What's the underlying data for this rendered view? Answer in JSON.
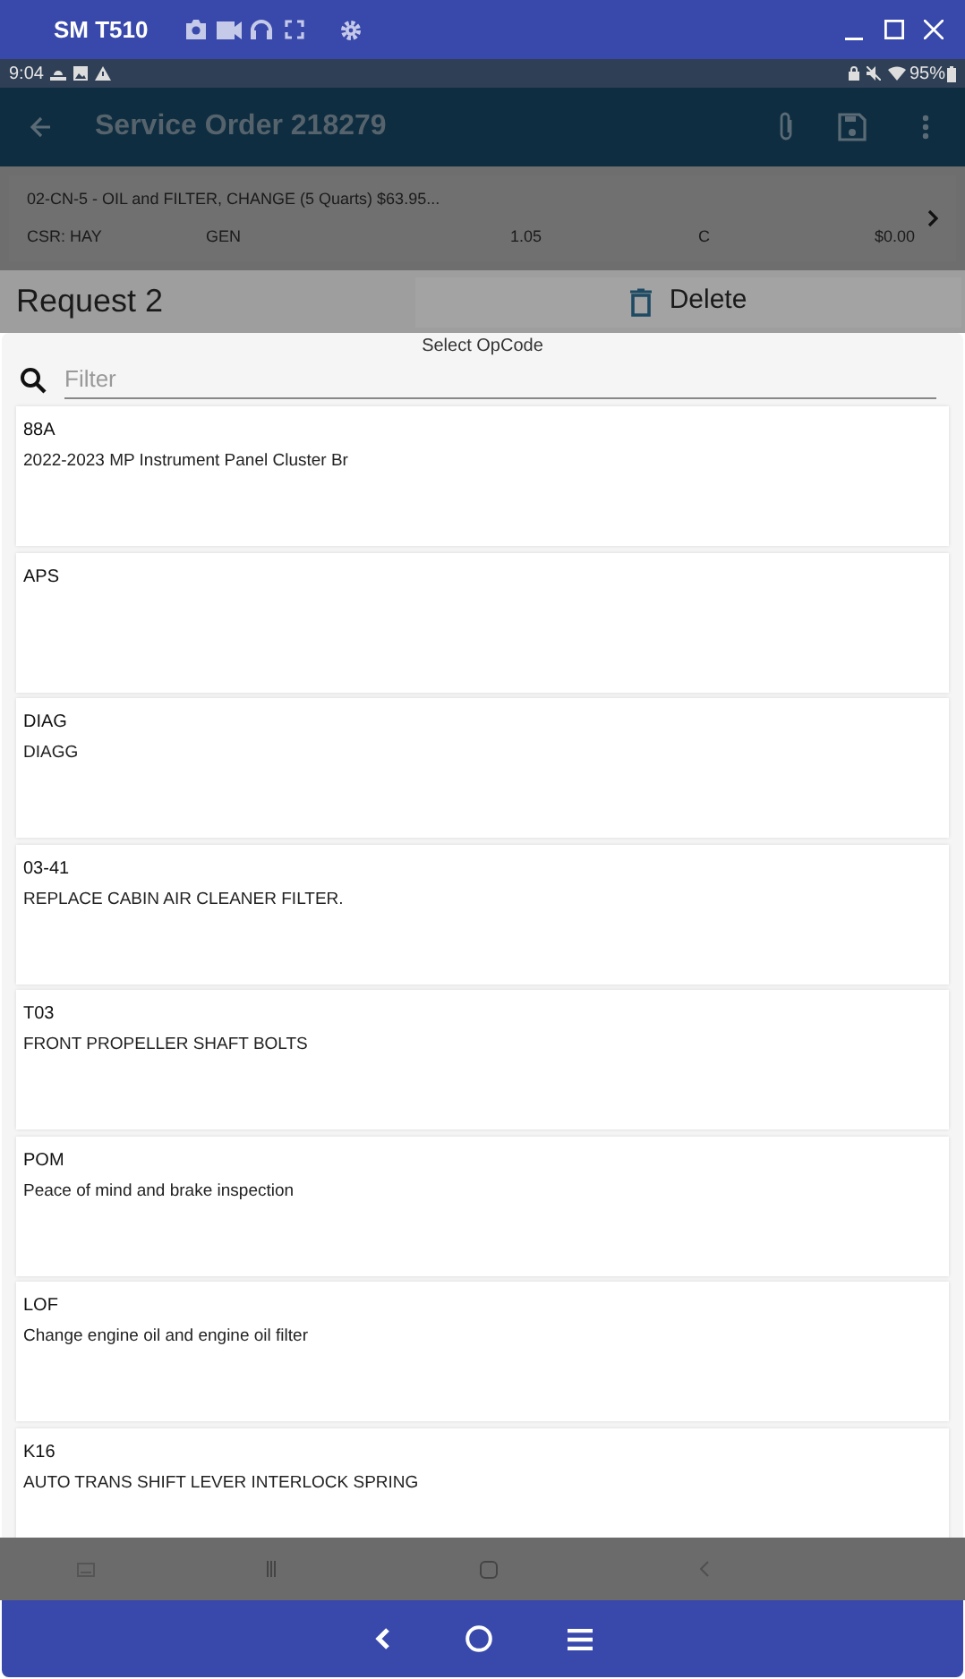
{
  "emulator": {
    "title": "SM T510"
  },
  "status_bar": {
    "time": "9:04",
    "battery": "95%"
  },
  "app_bar": {
    "title": "Service Order 218279"
  },
  "order_line": {
    "description": "02-CN-5 - OIL and FILTER, CHANGE (5 Quarts) $63.95...",
    "columns": [
      "CSR: HAY",
      "GEN",
      "1.05",
      "C",
      "$0.00"
    ]
  },
  "request": {
    "title": "Request 2",
    "delete_label": "Delete"
  },
  "dialog": {
    "title": "Select OpCode",
    "filter": {
      "placeholder": "Filter"
    },
    "items": [
      {
        "code": "88A",
        "description": "2022-2023 MP Instrument Panel Cluster Br"
      },
      {
        "code": "APS"
      },
      {
        "code": "DIAG",
        "description": "DIAGG"
      },
      {
        "code": "03-41",
        "description": "REPLACE CABIN AIR CLEANER FILTER."
      },
      {
        "code": "T03",
        "description": "FRONT PROPELLER SHAFT BOLTS"
      },
      {
        "code": "POM",
        "description": "Peace of mind and brake inspection"
      },
      {
        "code": "LOF",
        "description": "Change engine oil and engine oil filter"
      },
      {
        "code": "K16",
        "description": "AUTO TRANS SHIFT LEVER INTERLOCK SPRING"
      }
    ]
  }
}
